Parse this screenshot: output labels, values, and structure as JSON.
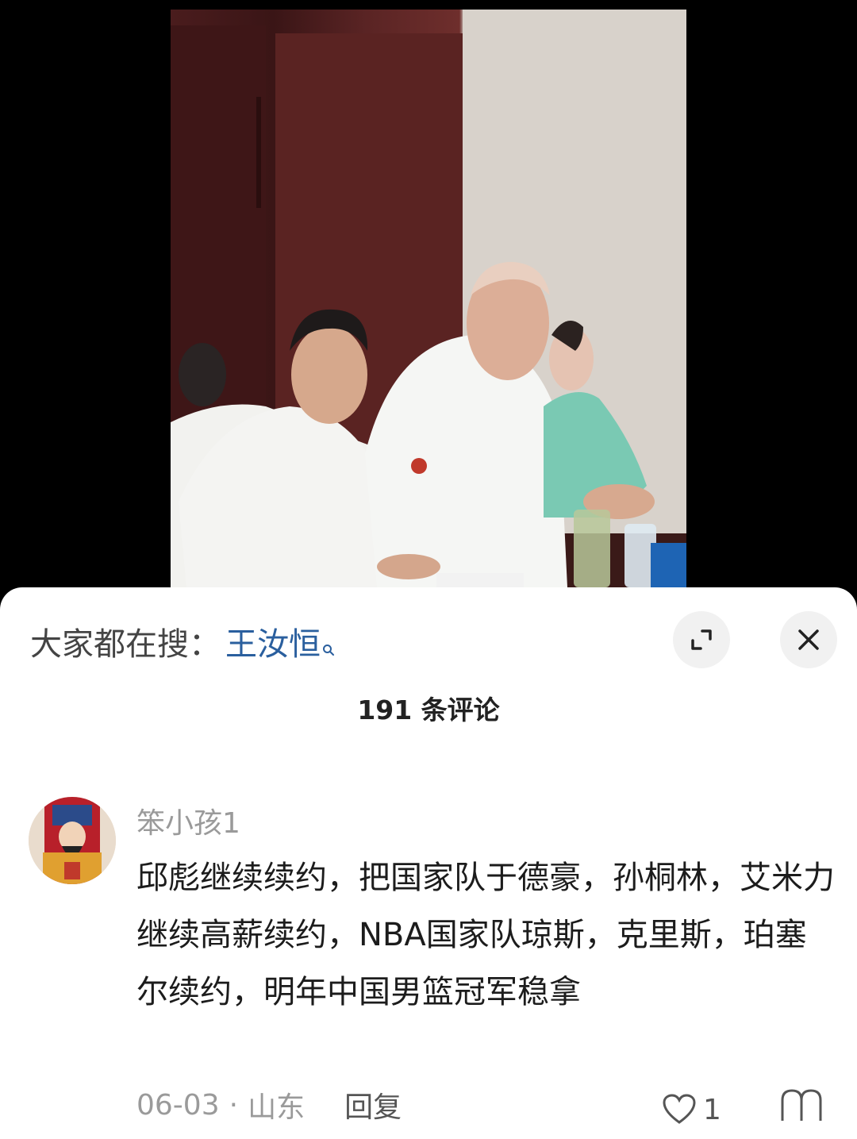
{
  "video": {
    "description_alt": ""
  },
  "search": {
    "prefix": "大家都在搜：",
    "term": "王汝恒"
  },
  "icons": {
    "expand": "expand-icon",
    "close": "close-icon",
    "search": "search-icon",
    "like": "heart-icon",
    "more": "more-icon"
  },
  "comments": {
    "count_label": "191 条评论",
    "items": [
      {
        "user": "笨小孩1",
        "text": "邱彪继续续约，把国家队于德豪，孙桐林，艾米力继续高薪续约，NBA国家队琼斯，克里斯，珀塞尔续约，明年中国男篮冠军稳拿",
        "date": "06-03",
        "separator": "·",
        "location": "山东",
        "reply_label": "回复",
        "likes": "1"
      }
    ]
  },
  "colors": {
    "search_term": "#2a5f9e",
    "sheet_bg": "#ffffff",
    "muted_text": "#9a9a9a"
  }
}
